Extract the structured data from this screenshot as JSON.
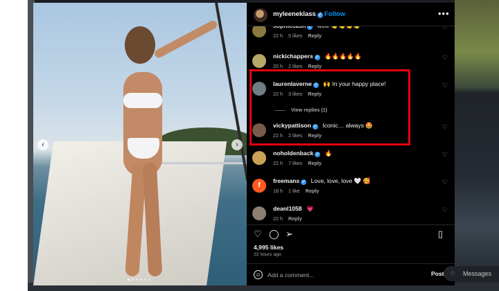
{
  "post": {
    "username": "myleeneklass",
    "separator": "•",
    "follow_label": "Follow",
    "more_icon": "more-horizontal-icon"
  },
  "comments": [
    {
      "username": "sophiecash",
      "text": "",
      "time": "22 h",
      "likes": "5 likes",
      "reply": "Reply",
      "verified": true,
      "avatar_color": "#8a7a40"
    },
    {
      "username": "nickichappers",
      "text": "🔥🔥🔥🔥🔥",
      "time": "20 h",
      "likes": "2 likes",
      "reply": "Reply",
      "verified": true,
      "avatar_color": "#b7a86a"
    },
    {
      "username": "laurenlaverne",
      "text": "🙌 In your happy place!",
      "time": "22 h",
      "likes": "3 likes",
      "reply": "Reply",
      "verified": true,
      "avatar_color": "#6f7d86"
    },
    {
      "username": "vickypattison",
      "text": "Iconic… always 🤩",
      "time": "22 h",
      "likes": "2 likes",
      "reply": "Reply",
      "verified": true,
      "avatar_color": "#7a5a4a"
    },
    {
      "username": "noholdenback",
      "text": "🔥",
      "time": "22 h",
      "likes": "7 likes",
      "reply": "Reply",
      "verified": true,
      "avatar_color": "#c9a255"
    },
    {
      "username": "freemans",
      "text": "Love, love, love 🤍 🥰",
      "time": "18 h",
      "likes": "1 like",
      "reply": "Reply",
      "verified": true,
      "avatar_color": "#ff5a1f"
    },
    {
      "username": "deanl1058",
      "text": "💗",
      "time": "22 h",
      "likes": "",
      "reply": "Reply",
      "verified": false,
      "avatar_color": "#8a7f70"
    }
  ],
  "view_replies_label": "View replies (1)",
  "engagement": {
    "likes": "4,995 likes",
    "time_ago": "22 hours ago"
  },
  "composer": {
    "placeholder": "Add a comment...",
    "post_label": "Post"
  },
  "messages": {
    "label": "Messages"
  },
  "colors": {
    "highlight": "#e5000e",
    "link_blue": "#0095f6",
    "verified_blue": "#3897f0"
  }
}
